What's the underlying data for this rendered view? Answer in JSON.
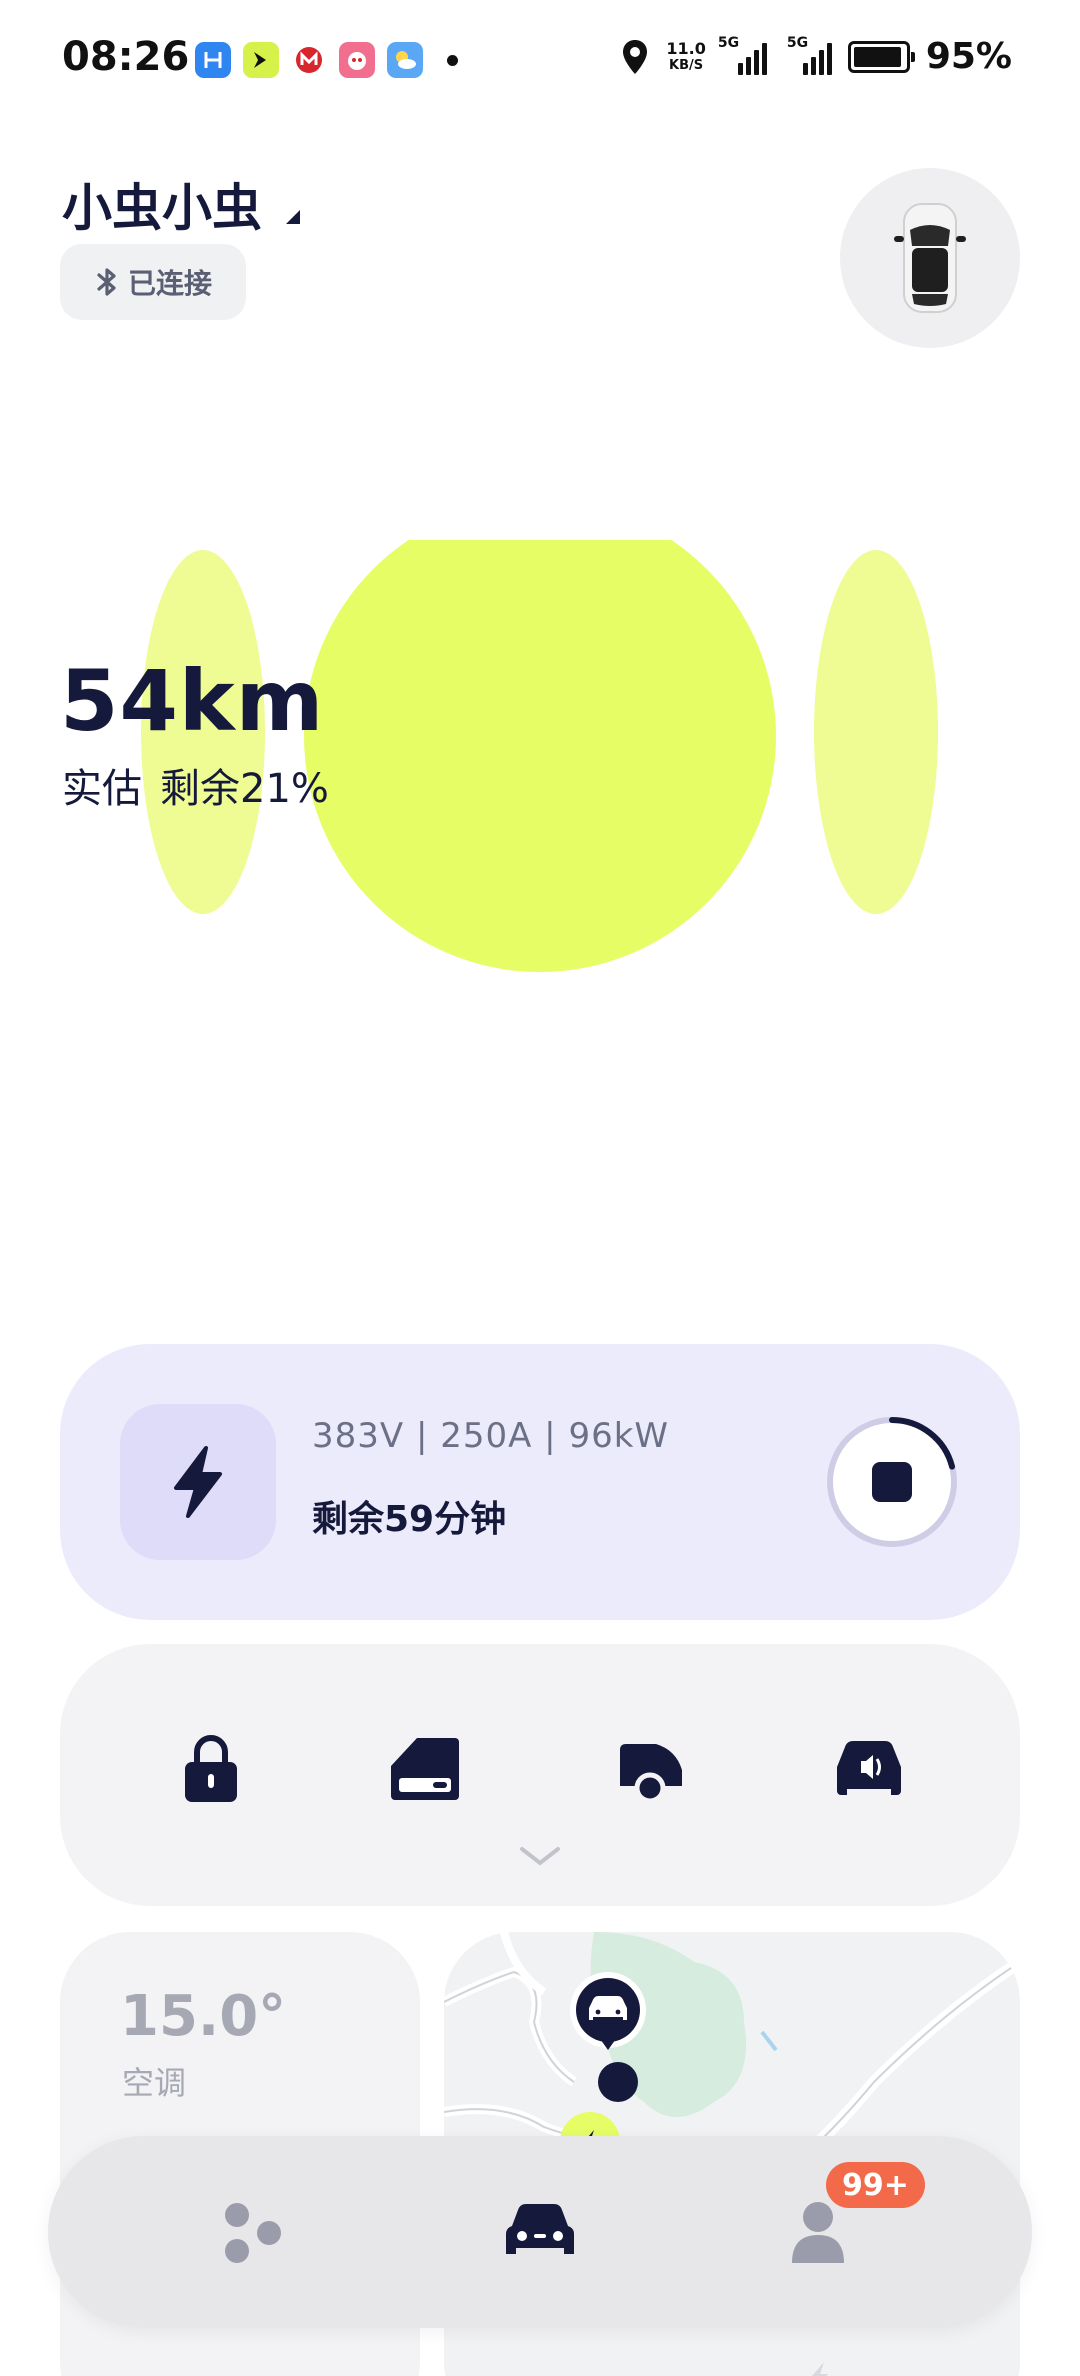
{
  "status_bar": {
    "time": "08:26",
    "net_speed_value": "11.0",
    "net_speed_unit": "KB/S",
    "signal_1_label": "5G",
    "signal_2_label": "5G",
    "battery_percent": "95%",
    "battery_level": 0.95,
    "app_icons": [
      "h-app-icon",
      "arrow-app-icon",
      "metro-app-icon",
      "promo-app-icon",
      "weather-app-icon"
    ]
  },
  "header": {
    "car_name": "小虫小虫",
    "connection_status": "已连接",
    "connection_icon": "bluetooth-icon"
  },
  "hero": {
    "range": "54km",
    "range_type": "实估",
    "remaining": "剩余21%",
    "accent_color": "#e6fd66"
  },
  "charging": {
    "stats": "383V | 250A | 96kW",
    "time_remaining": "剩余59分钟",
    "progress": 0.21,
    "icon": "lightning-icon",
    "stop_icon": "stop-icon"
  },
  "controls": {
    "items": [
      "lock-icon",
      "window-icon",
      "trunk-icon",
      "horn-icon"
    ],
    "expand_icon": "chevron-down-icon"
  },
  "climate": {
    "temperature": "15.0°",
    "label": "空调"
  },
  "map": {
    "car_marker_icon": "car-icon",
    "charger_marker_icon": "charging-pile-icon"
  },
  "bottom_nav": {
    "items": [
      "discover-icon",
      "car-icon",
      "profile-icon"
    ],
    "badge": "99+"
  },
  "colors": {
    "primary_dark": "#15193b",
    "lime": "#e6fd66",
    "lavender": "#ecebfb",
    "badge_red": "#f26a4a"
  }
}
